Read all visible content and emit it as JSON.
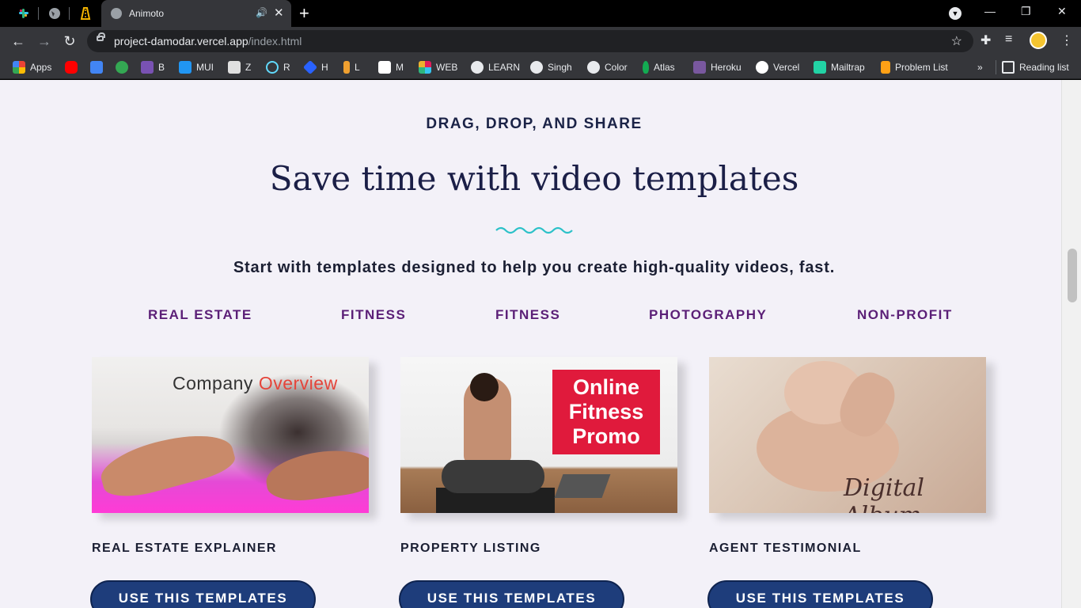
{
  "browser": {
    "tab_title": "Animoto",
    "url_host": "project-damodar.vercel.app",
    "url_path": "/index.html"
  },
  "bookmarks": [
    {
      "label": "Apps",
      "icon": "apps-grid-icon",
      "color": "#ea4335"
    },
    {
      "label": "",
      "icon": "youtube-icon",
      "color": "#ff0000"
    },
    {
      "label": "",
      "icon": "google-translate-icon",
      "color": "#4285f4"
    },
    {
      "label": "",
      "icon": "counter-icon",
      "color": "#34a853"
    },
    {
      "label": "B",
      "icon": "bootstrap-icon",
      "color": "#7952b3"
    },
    {
      "label": "MUI",
      "icon": "mui-icon",
      "color": "#2196f3"
    },
    {
      "label": "Z",
      "icon": "zoho-icon",
      "color": "#e0e0e0"
    },
    {
      "label": "R",
      "icon": "react-icon",
      "color": "#61dafb"
    },
    {
      "label": "H",
      "icon": "hashnode-icon",
      "color": "#2962ff"
    },
    {
      "label": "L",
      "icon": "linktree-icon",
      "color": "#f0a030"
    },
    {
      "label": "M",
      "icon": "medium-icon",
      "color": "#ffffff"
    },
    {
      "label": "WEB",
      "icon": "slack-icon",
      "color": "#e01e5a"
    },
    {
      "label": "LEARN",
      "icon": "globe-icon",
      "color": "#e8eaed"
    },
    {
      "label": "Singh",
      "icon": "github-icon",
      "color": "#e8eaed"
    },
    {
      "label": "Color",
      "icon": "globe-icon",
      "color": "#e8eaed"
    },
    {
      "label": "Atlas",
      "icon": "mongodb-icon",
      "color": "#13aa52"
    },
    {
      "label": "Heroku",
      "icon": "heroku-icon",
      "color": "#79589f"
    },
    {
      "label": "Vercel",
      "icon": "vercel-icon",
      "color": "#000000"
    },
    {
      "label": "Mailtrap",
      "icon": "mailtrap-icon",
      "color": "#22d3a5"
    },
    {
      "label": "Problem List",
      "icon": "leetcode-icon",
      "color": "#ffa116"
    }
  ],
  "reading_list": "Reading list",
  "page": {
    "eyebrow": "DRAG, DROP, AND SHARE",
    "headline": "Save time with video templates",
    "subhead": "Start with templates designed to help you create high-quality videos, fast.",
    "categories": [
      "REAL ESTATE",
      "FITNESS",
      "FITNESS",
      "PHOTOGRAPHY",
      "NON-PROFIT"
    ],
    "accent_color": "#5b1f77",
    "button_color": "#1e3d7b",
    "cards": [
      {
        "title": "REAL ESTATE EXPLAINER",
        "button": "USE THIS TEMPLATES",
        "image_text_a": "Company ",
        "image_text_b": "Overview"
      },
      {
        "title": "PROPERTY LISTING",
        "button": "USE THIS TEMPLATES",
        "image_text": "Online Fitness Promo"
      },
      {
        "title": "AGENT TESTIMONIAL",
        "button": "USE THIS TEMPLATES",
        "image_text": "Digital Album"
      }
    ]
  }
}
